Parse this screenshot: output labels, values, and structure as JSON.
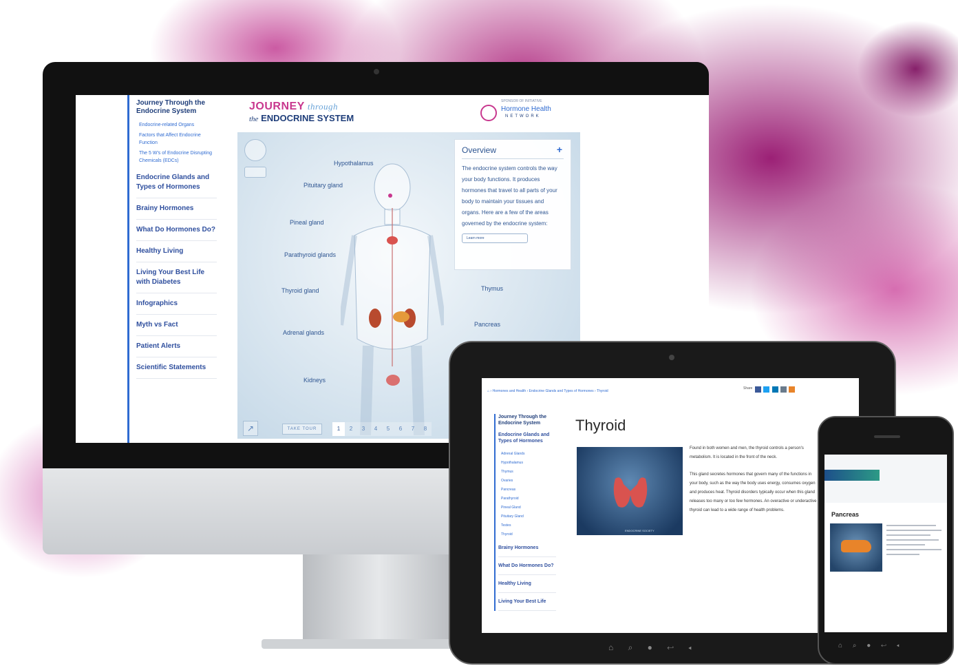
{
  "imac": {
    "sidebar": {
      "title": "Journey Through the Endocrine System",
      "subitems": [
        "Endocrine-related Organs",
        "Factors that Affect Endocrine Function",
        "The 5 W's of Endocrine Disrupting Chemicals (EDCs)"
      ],
      "items": [
        "Endocrine Glands and Types of Hormones",
        "Brainy Hormones",
        "What Do Hormones Do?",
        "Healthy Living",
        "Living Your Best Life with Diabetes",
        "Infographics",
        "Myth vs Fact",
        "Patient Alerts",
        "Scientific Statements"
      ]
    },
    "logo": {
      "line1": "JOURNEY",
      "line1_script": "through",
      "line2_script": "the",
      "line2": "ENDOCRINE SYSTEM"
    },
    "partner_logo": {
      "sponsor": "SPONSOR OF INITIATIVE",
      "name": "Hormone Health",
      "network": "NETWORK"
    },
    "viewer": {
      "labels": {
        "hypothalamus": "Hypothalamus",
        "pituitary": "Pituitary gland",
        "pineal": "Pineal gland",
        "parathyroid": "Parathyroid glands",
        "thyroid": "Thyroid gland",
        "thymus": "Thymus",
        "pancreas": "Pancreas",
        "adrenal": "Adrenal glands",
        "kidneys": "Kidneys"
      },
      "overview": {
        "heading": "Overview",
        "plus": "+",
        "text": "The endocrine system controls the way your body functions. It produces hormones that travel to all parts of your body to maintain your tissues and organs. Here are a few of the areas governed by the endocrine system:",
        "button": "Learn more"
      },
      "expand": "↗",
      "tour_label": "TAKE TOUR",
      "pages": [
        "1",
        "2",
        "3",
        "4",
        "5",
        "6",
        "7",
        "8"
      ]
    }
  },
  "tablet": {
    "breadcrumb": "⌂ › Hormones and Health › Endocrine Glands and Types of Hormones › Thyroid",
    "share_label": "Share",
    "sidebar": {
      "title": "Journey Through the Endocrine System",
      "section": "Endocrine Glands and Types of Hormones",
      "subitems": [
        "Adrenal Glands",
        "Hypothalamus",
        "Thymus",
        "Ovaries",
        "Pancreas",
        "Parathyroid",
        "Pineal Gland",
        "Pituitary Gland",
        "Testes",
        "Thyroid"
      ],
      "items": [
        "Brainy Hormones",
        "What Do Hormones Do?",
        "Healthy Living",
        "Living Your Best Life"
      ]
    },
    "title": "Thyroid",
    "image_caption": "ENDOCRINE SOCIETY",
    "paragraph1": "Found in both women and men, the thyroid controls a person's metabolism. It is located in the front of the neck.",
    "paragraph2": "This gland secretes hormones that govern many of the functions in your body, such as the way the body uses energy, consumes oxygen and produces heat. Thyroid disorders typically occur when this gland releases too many or too few hormones. An overactive or underactive thyroid can lead to a wide range of health problems.",
    "nav_icons": "⌂ ⌕ ● ↩ ◂"
  },
  "phone": {
    "title": "Pancreas",
    "nav_icons": "⌂ ⌕ ● ↩ ◂"
  },
  "colors": {
    "accent_blue": "#2f6bd1",
    "navy": "#1f3e7a",
    "magenta": "#c8378e",
    "thyroid_red": "#d9534f",
    "pancreas_orange": "#e8842a"
  }
}
